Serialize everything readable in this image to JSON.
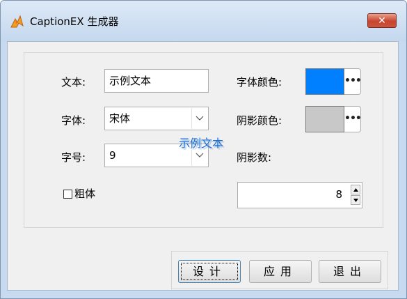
{
  "window": {
    "title": "CaptionEX 生成器",
    "close_label": "✕"
  },
  "form": {
    "text_label": "文本:",
    "text_value": "示例文本",
    "font_label": "字体:",
    "font_value": "宋体",
    "size_label": "字号:",
    "size_value": "9",
    "bold_label": "粗体",
    "bold_checked": false,
    "font_color_label": "字体颜色:",
    "font_color": "#0080ff",
    "shadow_color_label": "阴影颜色:",
    "shadow_color": "#c8c8c8",
    "shadow_count_label": "阴影数:",
    "shadow_count_value": "8",
    "dots_label": "•••",
    "preview_text": "示例文本"
  },
  "buttons": {
    "design": "设计",
    "apply": "应用",
    "exit": "退出"
  }
}
